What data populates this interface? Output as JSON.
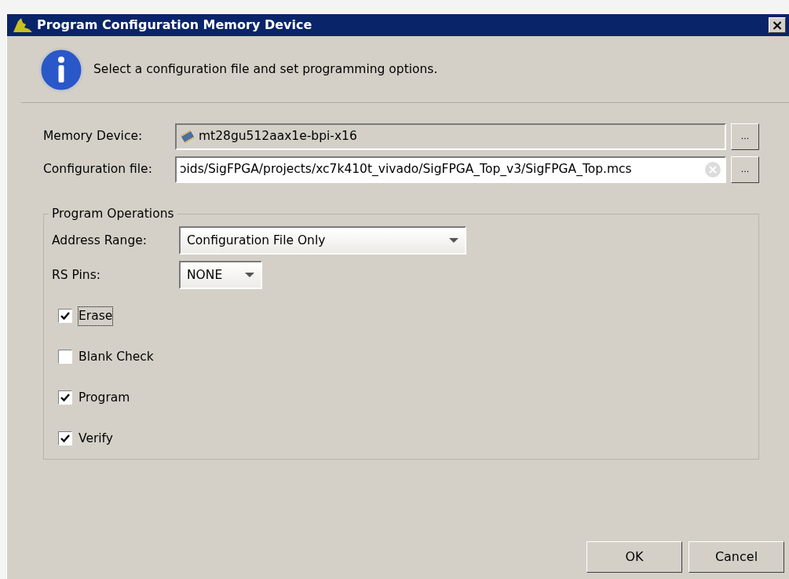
{
  "window": {
    "title": "Program Configuration Memory Device",
    "close": "×"
  },
  "message": "Select a configuration file and set programming options.",
  "memory_device": {
    "label": "Memory Device:",
    "value": "mt28gu512aax1e-bpi-x16",
    "browse": "...",
    "disabled": true
  },
  "configuration_file": {
    "label": "Configuration file:",
    "value": "ɔids/SigFPGA/projects/xc7k410t_vivado/SigFPGA_Top_v3/SigFPGA_Top.mcs",
    "browse": "..."
  },
  "program_operations": {
    "title": "Program Operations",
    "address_range": {
      "label": "Address Range:",
      "value": "Configuration File Only"
    },
    "rs_pins": {
      "label": "RS Pins:",
      "value": "NONE"
    },
    "options": [
      {
        "label": "Erase",
        "checked": true,
        "focused": true
      },
      {
        "label": "Blank Check",
        "checked": false,
        "focused": false
      },
      {
        "label": "Program",
        "checked": true,
        "focused": false
      },
      {
        "label": "Verify",
        "checked": true,
        "focused": false
      }
    ]
  },
  "buttons": [
    {
      "label": "OK"
    },
    {
      "label": "Cancel"
    }
  ]
}
